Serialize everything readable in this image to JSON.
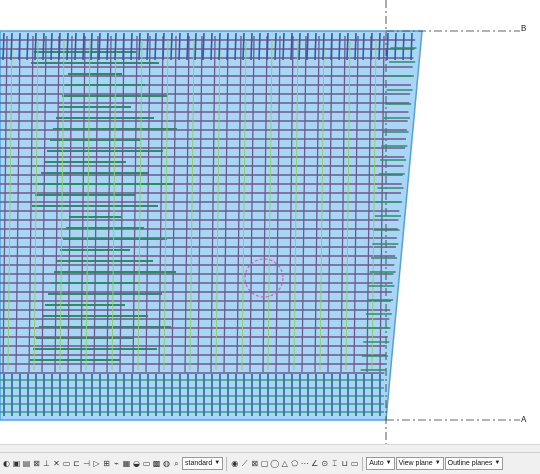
{
  "viewport": {
    "grid_labels": {
      "top": "B",
      "bottom": "A"
    },
    "colors": {
      "slab_fill": "#aad6f5",
      "slab_edge": "#4aa3e8",
      "bar_purple": "#6b5a8c",
      "bar_green": "#2e8b6a",
      "bar_lightgreen": "#8fcf6a",
      "bar_blue": "#2a5fb0",
      "opening": "#d060c0",
      "grid_line": "#333333"
    }
  },
  "toolbar": {
    "icons": [
      "snap-grid-icon",
      "snap-end-icon",
      "snap-mid-icon",
      "snap-intersection-icon",
      "snap-perpendicular-icon",
      "snap-center-icon",
      "snap-nearest-icon",
      "snap-line-icon",
      "snap-free-icon",
      "snap-extension-icon",
      "select-all-icon",
      "select-part-icon",
      "select-rebar-icon",
      "select-weld-icon",
      "select-cut-icon",
      "select-grid-icon",
      "select-view-icon",
      "select-point-icon"
    ],
    "view_select": "standard",
    "icons2": [
      "circle-icon",
      "rebar-group-icon",
      "select-box-icon",
      "select-box2-icon",
      "ortho-icon",
      "triangle-icon",
      "polygon-icon",
      "measure-icon",
      "angle-icon",
      "radius-icon",
      "point-icon",
      "pin-icon",
      "label-icon"
    ],
    "plane_auto": "Auto",
    "plane_view": "View plane",
    "plane_outline": "Outline planes"
  }
}
